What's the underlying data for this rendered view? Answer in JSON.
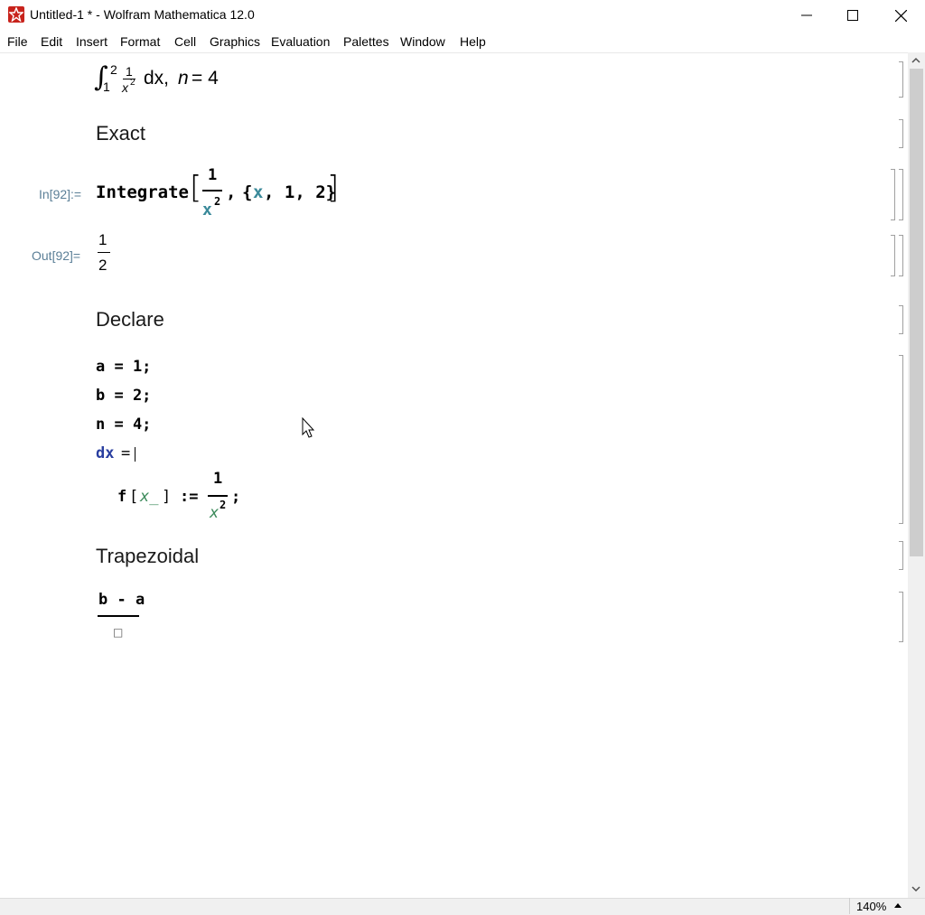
{
  "window": {
    "title": "Untitled-1 * - Wolfram Mathematica 12.0"
  },
  "menu": [
    "File",
    "Edit",
    "Insert",
    "Format",
    "Cell",
    "Graphics",
    "Evaluation",
    "Palettes",
    "Window",
    "Help"
  ],
  "cells": {
    "integral_desc": {
      "lower": "1",
      "upper": "2",
      "num": "1",
      "den_base": "x",
      "den_exp": "2",
      "tail_dx": "dx,",
      "tail_n": "n",
      "tail_eq": "= 4"
    },
    "exact_heading": "Exact",
    "input_label": "In[92]:=",
    "integrate": {
      "fn": "Integrate",
      "num": "1",
      "den_base": "x",
      "den_exp": "2",
      "comma": ",",
      "open_brace": "{",
      "var": "x",
      "rest": ", 1, 2}"
    },
    "output_label": "Out[92]=",
    "output": {
      "num": "1",
      "den": "2"
    },
    "declare_heading": "Declare",
    "declare_lines": [
      "a = 1;",
      "b = 2;",
      "n = 4;"
    ],
    "dx_line": {
      "var": "dx",
      "op": "="
    },
    "f_def": {
      "f": "f",
      "open": "[",
      "arg": "x_",
      "close": "]",
      "assign": ":=",
      "num": "1",
      "den_base": "x",
      "den_exp": "2",
      "semi": ";"
    },
    "trapezoidal_heading": "Trapezoidal",
    "trap_frac": {
      "num": "b - a",
      "placeholder": "□"
    }
  },
  "status": {
    "zoom": "140%"
  },
  "colors": {
    "label": "#5b7f97",
    "var_teal": "#3b8a9a",
    "var_green": "#3b8a5a",
    "dx_blue": "#2a3fa0",
    "app_red": "#c8231c"
  }
}
